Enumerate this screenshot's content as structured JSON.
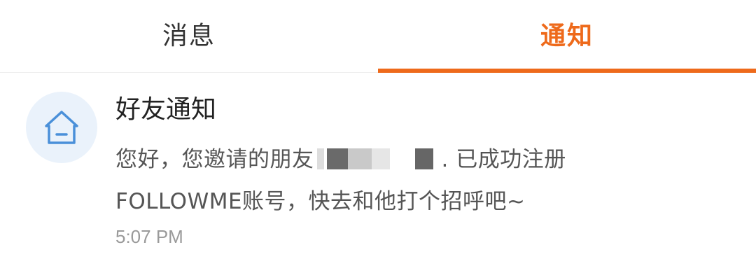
{
  "tabs": [
    {
      "label": "消息",
      "active": false
    },
    {
      "label": "通知",
      "active": true
    }
  ],
  "accent_color": "#ee6a1b",
  "notification": {
    "icon": "home-icon",
    "title": "好友通知",
    "body_part1": "您好，您邀请的朋友",
    "body_part2": ". 已成功注册",
    "body_line2": "FOLLOWME账号，快去和他打个招呼吧~",
    "time": "5:07 PM"
  }
}
